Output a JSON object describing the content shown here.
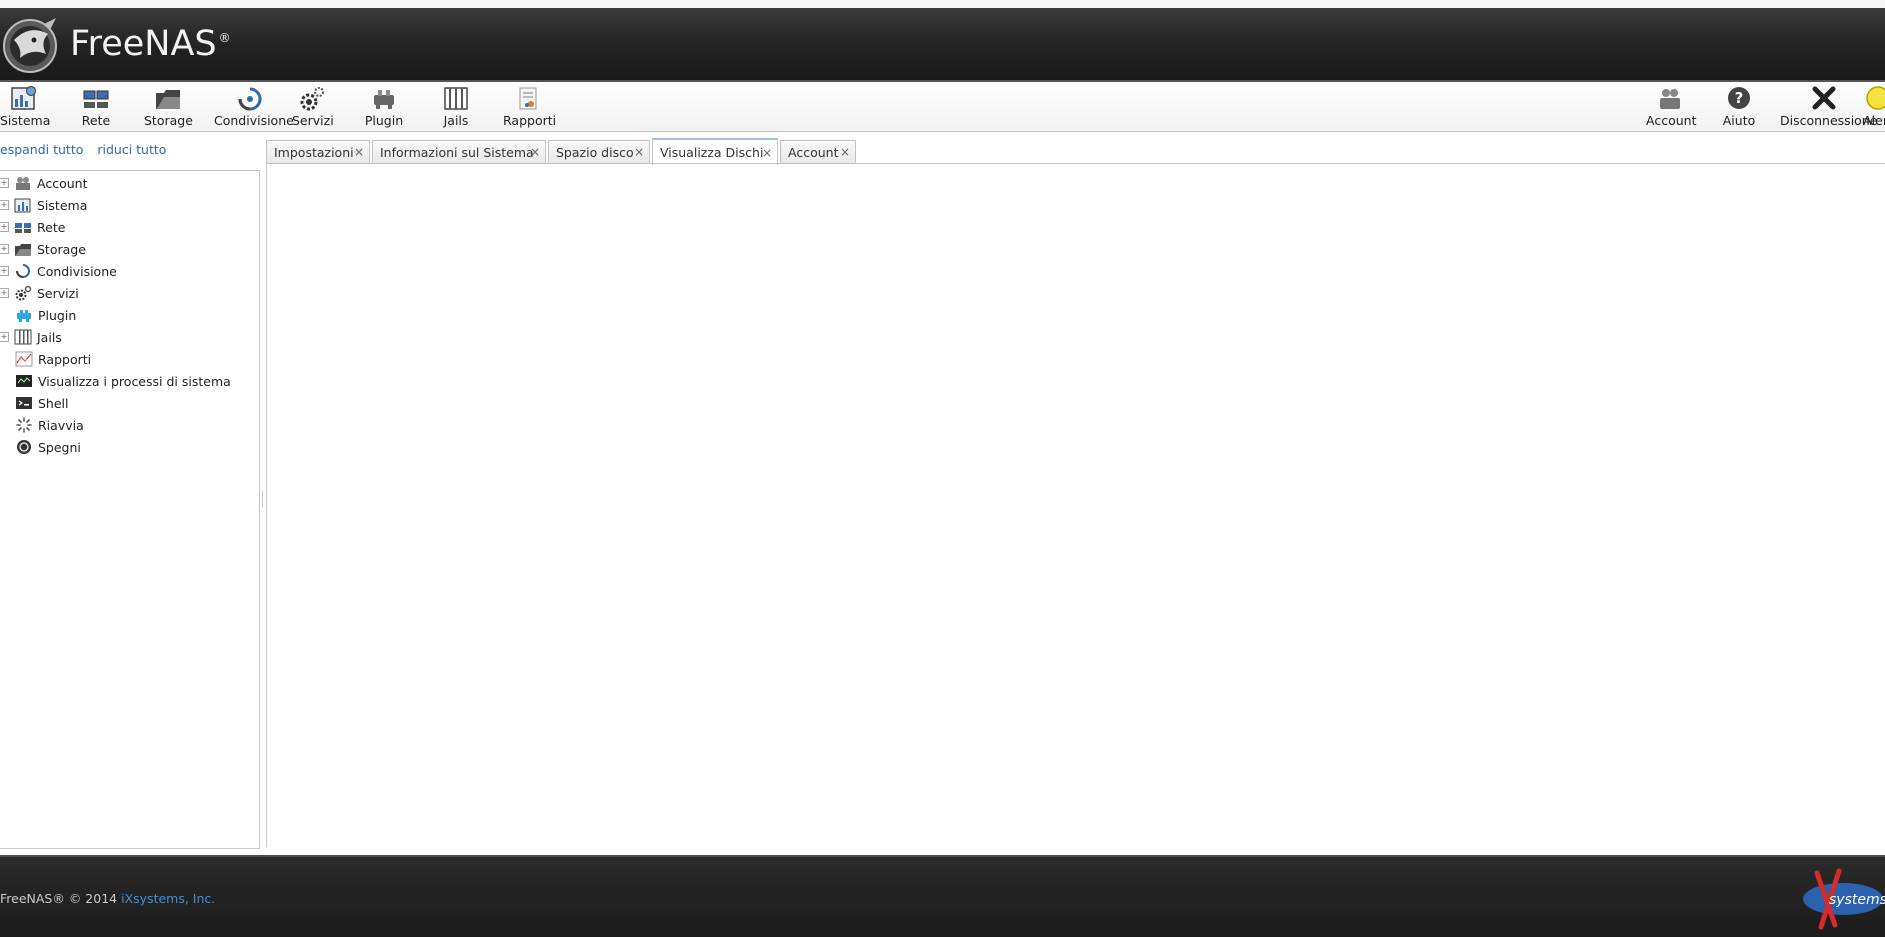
{
  "header": {
    "brand": "FreeNAS",
    "registered_mark": "®"
  },
  "toolbar": {
    "left": [
      {
        "label": "Sistema",
        "icon": "system-chart-icon"
      },
      {
        "label": "Rete",
        "icon": "network-icon"
      },
      {
        "label": "Storage",
        "icon": "storage-icon"
      },
      {
        "label": "Condivisione",
        "icon": "sharing-icon"
      },
      {
        "label": "Servizi",
        "icon": "services-gear-icon"
      },
      {
        "label": "Plugin",
        "icon": "plugin-icon"
      },
      {
        "label": "Jails",
        "icon": "jails-icon"
      },
      {
        "label": "Rapporti",
        "icon": "reports-icon"
      }
    ],
    "right": [
      {
        "label": "Account",
        "icon": "account-icon"
      },
      {
        "label": "Aiuto",
        "icon": "help-icon"
      },
      {
        "label": "Disconnessione",
        "icon": "logout-icon"
      },
      {
        "label": "Alert",
        "icon": "alert-light-icon"
      }
    ]
  },
  "sidebar": {
    "expand_all": "espandi tutto",
    "collapse_all": "riduci tutto",
    "tree": [
      {
        "label": "Account",
        "expandable": true,
        "icon": "account-icon"
      },
      {
        "label": "Sistema",
        "expandable": true,
        "icon": "system-chart-icon"
      },
      {
        "label": "Rete",
        "expandable": true,
        "icon": "network-icon"
      },
      {
        "label": "Storage",
        "expandable": true,
        "icon": "storage-icon"
      },
      {
        "label": "Condivisione",
        "expandable": true,
        "icon": "sharing-icon"
      },
      {
        "label": "Servizi",
        "expandable": true,
        "icon": "services-gear-icon"
      },
      {
        "label": "Plugin",
        "expandable": false,
        "icon": "plugin-icon"
      },
      {
        "label": "Jails",
        "expandable": true,
        "icon": "jails-icon"
      },
      {
        "label": "Rapporti",
        "expandable": false,
        "icon": "reports-icon"
      },
      {
        "label": "Visualizza i processi di sistema",
        "expandable": false,
        "icon": "processes-icon"
      },
      {
        "label": "Shell",
        "expandable": false,
        "icon": "shell-icon"
      },
      {
        "label": "Riavvia",
        "expandable": false,
        "icon": "reboot-icon"
      },
      {
        "label": "Spegni",
        "expandable": false,
        "icon": "shutdown-icon"
      }
    ]
  },
  "tabs": {
    "items": [
      {
        "label": "Impostazioni",
        "active": false
      },
      {
        "label": "Informazioni sul Sistema",
        "active": false
      },
      {
        "label": "Spazio disco",
        "active": false
      },
      {
        "label": "Visualizza Dischi",
        "active": true
      },
      {
        "label": "Account",
        "active": false
      }
    ],
    "close_glyph": "×"
  },
  "footer": {
    "copyright": "FreeNAS® © 2014",
    "company_link": "iXsystems, Inc.",
    "logo_text": "systems"
  },
  "colors": {
    "header_bg": "#222222",
    "link": "#2f6aa8",
    "footer_link": "#3c8fd8",
    "active_tab_accent": "#9ec3e6"
  }
}
